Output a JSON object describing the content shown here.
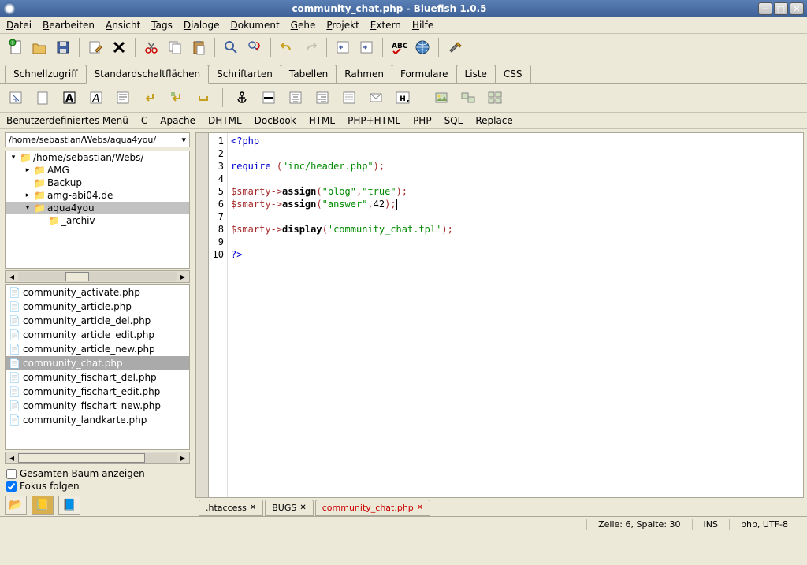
{
  "window": {
    "title": "community_chat.php - Bluefish 1.0.5"
  },
  "menubar": [
    "Datei",
    "Bearbeiten",
    "Ansicht",
    "Tags",
    "Dialoge",
    "Dokument",
    "Gehe",
    "Projekt",
    "Extern",
    "Hilfe"
  ],
  "main_tabs": [
    "Schnellzugriff",
    "Standardschaltflächen",
    "Schriftarten",
    "Tabellen",
    "Rahmen",
    "Formulare",
    "Liste",
    "CSS"
  ],
  "main_tabs_active": 1,
  "toolbar3": [
    "Benutzerdefiniertes Menü",
    "C",
    "Apache",
    "DHTML",
    "DocBook",
    "HTML",
    "PHP+HTML",
    "PHP",
    "SQL",
    "Replace"
  ],
  "sidebar": {
    "path": "/home/sebastian/Webs/aqua4you/",
    "tree": [
      {
        "indent": 0,
        "exp": "▾",
        "label": "/home/sebastian/Webs/",
        "sel": false
      },
      {
        "indent": 1,
        "exp": "▸",
        "label": "AMG",
        "sel": false
      },
      {
        "indent": 1,
        "exp": "",
        "label": "Backup",
        "sel": false
      },
      {
        "indent": 1,
        "exp": "▸",
        "label": "amg-abi04.de",
        "sel": false
      },
      {
        "indent": 1,
        "exp": "▾",
        "label": "aqua4you",
        "sel": true
      },
      {
        "indent": 2,
        "exp": "",
        "label": "_archiv",
        "sel": false
      }
    ],
    "files": [
      "community_activate.php",
      "community_article.php",
      "community_article_del.php",
      "community_article_edit.php",
      "community_article_new.php",
      "community_chat.php",
      "community_fischart_del.php",
      "community_fischart_edit.php",
      "community_fischart_new.php",
      "community_landkarte.php"
    ],
    "files_selected": 5,
    "check1": "Gesamten Baum anzeigen",
    "check2": "Fokus folgen",
    "check1_val": false,
    "check2_val": true
  },
  "editor": {
    "tabs": [
      {
        "label": ".htaccess",
        "active": false
      },
      {
        "label": "BUGS",
        "active": false
      },
      {
        "label": "community_chat.php",
        "active": true
      }
    ],
    "lines": 10,
    "code_html": "<span class='kw'>&lt;?php</span>\n\n<span class='kw'>require</span> <span class='op'>(</span><span class='str'>\"inc/header.php\"</span><span class='op'>);</span>\n\n<span class='var'>$smarty</span><span class='op'>-&gt;</span><span class='func'>assign</span><span class='op'>(</span><span class='str'>\"blog\"</span><span class='op'>,</span><span class='str'>\"true\"</span><span class='op'>);</span>\n<span class='var'>$smarty</span><span class='op'>-&gt;</span><span class='func'>assign</span><span class='op'>(</span><span class='str'>\"answer\"</span><span class='op'>,</span><span class='num'>42</span><span class='op'>);</span><span class='cursor'></span>\n\n<span class='var'>$smarty</span><span class='op'>-&gt;</span><span class='func'>display</span><span class='op'>(</span><span class='str'>'community_chat.tpl'</span><span class='op'>);</span>\n\n<span class='kw'>?&gt;</span>"
  },
  "statusbar": {
    "pos": "Zeile: 6, Spalte: 30",
    "ins": "INS",
    "mode": "php, UTF-8"
  }
}
